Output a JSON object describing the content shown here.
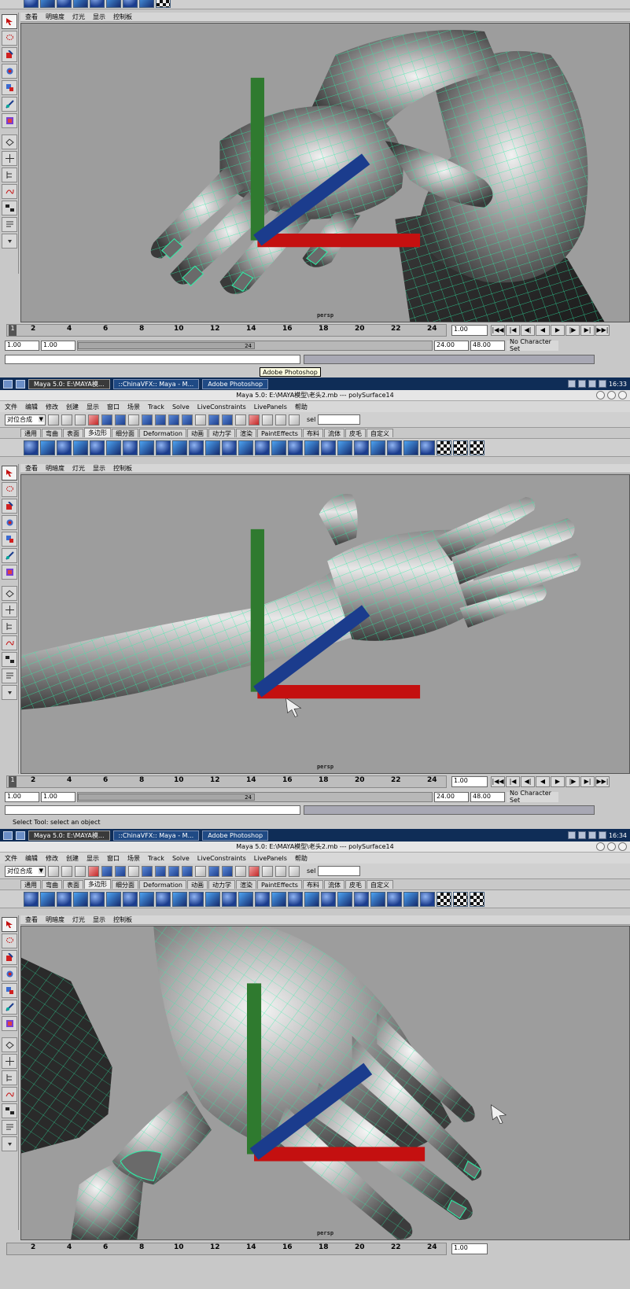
{
  "panel_menu": [
    "查看",
    "明暗度",
    "灯光",
    "显示",
    "控制板"
  ],
  "camera_label": "persp",
  "tooltip": "Adobe Photoshop",
  "taskbar": {
    "items": [
      "Maya 5.0: E:\\MAYA模...",
      "::ChinaVFX:: Maya - M...",
      "Adobe Photoshop"
    ],
    "time_1": "16:33",
    "time_2": "16:34"
  },
  "title": "Maya 5.0: E:\\MAYA模型\\老头2.mb  ---  polySurface14",
  "menus": [
    "文件",
    "编辑",
    "修改",
    "创建",
    "显示",
    "窗口",
    "场景",
    "Track",
    "Solve",
    "LiveConstraints",
    "LivePanels",
    "帮助"
  ],
  "mode_combo": "对位合成",
  "sel_label": "sel",
  "shelf_tabs": [
    "通用",
    "弯曲",
    "表面",
    "多边形",
    "细分面",
    "Deformation",
    "动画",
    "动力学",
    "渲染",
    "PaintEffects",
    "布料",
    "流体",
    "皮毛",
    "自定义"
  ],
  "timeline": {
    "ticks": [
      "2",
      "4",
      "6",
      "8",
      "10",
      "12",
      "14",
      "16",
      "18",
      "20",
      "22",
      "24"
    ],
    "current_frame": "1",
    "current_field": "1.00"
  },
  "range": {
    "start": "1.00",
    "play_start": "1.00",
    "slider_start": "1",
    "slider_end": "24",
    "play_end": "24.00",
    "end": "48.00",
    "char_set": "No Character Set"
  },
  "help_line": "Select Tool: select an object",
  "colors": {
    "wire": "#2ef0a8",
    "viewport_bg": "#9d9d9d"
  }
}
